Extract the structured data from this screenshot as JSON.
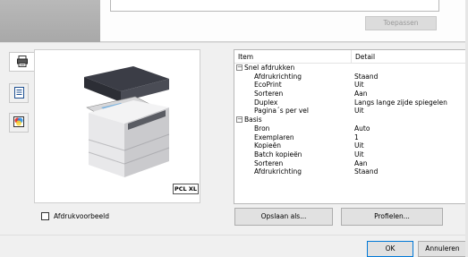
{
  "top": {
    "apply_label": "Toepassen"
  },
  "tabs": [
    {
      "name": "printer-settings-tab",
      "icon": "printer-icon"
    },
    {
      "name": "document-tab",
      "icon": "document-icon"
    },
    {
      "name": "color-tab",
      "icon": "color-icon"
    }
  ],
  "preview": {
    "badge": "PCL XL",
    "checkbox_label": "Afdrukvoorbeeld",
    "checkbox_checked": false
  },
  "table": {
    "headers": {
      "item": "Item",
      "detail": "Detail"
    },
    "groups": [
      {
        "label": "Snel afdrukken",
        "rows": [
          {
            "item": "Afdrukrichting",
            "detail": "Staand"
          },
          {
            "item": "EcoPrint",
            "detail": "Uit"
          },
          {
            "item": "Sorteren",
            "detail": "Aan"
          },
          {
            "item": "Duplex",
            "detail": "Langs lange zijde spiegelen"
          },
          {
            "item": "Pagina´s per vel",
            "detail": "Uit"
          }
        ]
      },
      {
        "label": "Basis",
        "rows": [
          {
            "item": "Bron",
            "detail": "Auto"
          },
          {
            "item": "Exemplaren",
            "detail": "1"
          },
          {
            "item": "Kopieën",
            "detail": "Uit"
          },
          {
            "item": "Batch kopieën",
            "detail": "Uit"
          },
          {
            "item": "Sorteren",
            "detail": "Aan"
          },
          {
            "item": "Afdrukrichting",
            "detail": "Staand"
          }
        ]
      }
    ]
  },
  "buttons": {
    "save_as": "Opslaan als...",
    "profiles": "Profielen...",
    "ok": "OK",
    "cancel": "Annuleren"
  },
  "colors": {
    "accent": "#0078d7",
    "window_bg": "#f0f0f0"
  }
}
